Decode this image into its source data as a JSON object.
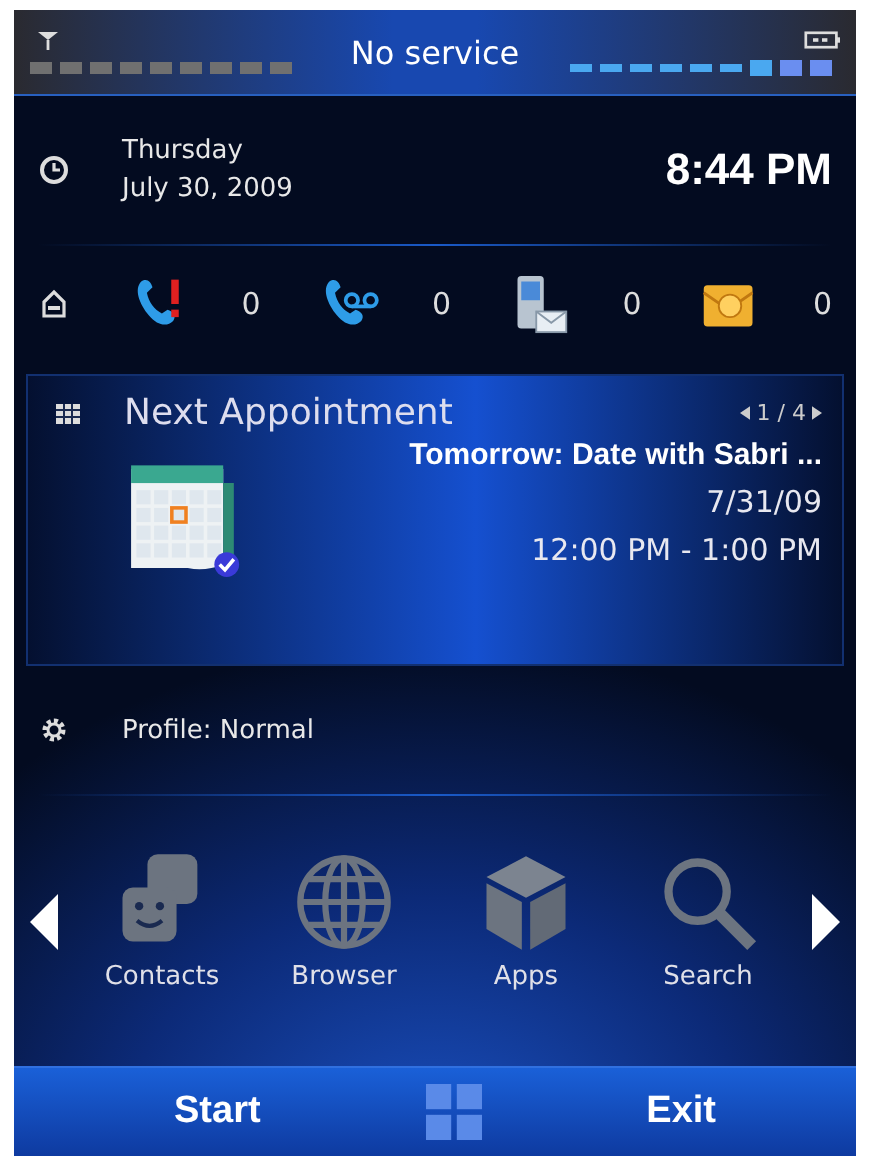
{
  "status_bar": {
    "carrier": "No service"
  },
  "clock": {
    "day": "Thursday",
    "date": "July 30, 2009",
    "time": "8:44 PM"
  },
  "notifications": [
    {
      "kind": "missed-call",
      "count": "0"
    },
    {
      "kind": "voicemail",
      "count": "0"
    },
    {
      "kind": "text-message",
      "count": "0"
    },
    {
      "kind": "email",
      "count": "0"
    }
  ],
  "appointment": {
    "heading": "Next Appointment",
    "pager": "1 / 4",
    "title": "Tomorrow: Date with Sabri ...",
    "date": "7/31/09",
    "time": "12:00 PM - 1:00 PM"
  },
  "profile": {
    "label": "Profile: Normal"
  },
  "apps": [
    {
      "kind": "contacts",
      "label": "Contacts"
    },
    {
      "kind": "browser",
      "label": "Browser"
    },
    {
      "kind": "apps",
      "label": "Apps"
    },
    {
      "kind": "search",
      "label": "Search"
    }
  ],
  "softkeys": {
    "left": "Start",
    "right": "Exit"
  }
}
